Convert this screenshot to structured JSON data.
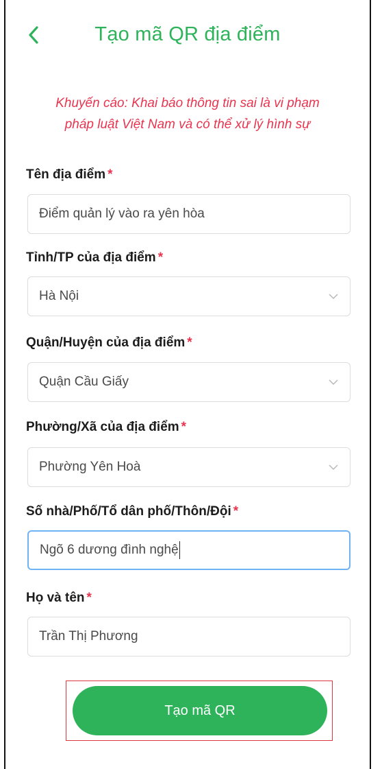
{
  "header": {
    "back_icon": "chevron-left-icon",
    "title": "Tạo mã QR địa điểm"
  },
  "warning": {
    "line1": "Khuyến cáo: Khai báo thông tin sai là vi phạm",
    "line2": "pháp luật Việt Nam và có thể xử lý hình sự"
  },
  "required_mark": "*",
  "form": {
    "location_name": {
      "label": "Tên địa điểm",
      "value": "Điểm quản lý vào ra yên hòa"
    },
    "province": {
      "label": "Tỉnh/TP của địa điểm",
      "value": "Hà Nội"
    },
    "district": {
      "label": "Quận/Huyện của địa điểm",
      "value": "Quận Cầu Giấy"
    },
    "ward": {
      "label": "Phường/Xã của địa điểm",
      "value": "Phường Yên Hoà"
    },
    "address": {
      "label": "Số nhà/Phố/Tổ dân phố/Thôn/Đội",
      "value": "Ngõ 6 dương đình nghệ"
    },
    "full_name": {
      "label": "Họ và tên",
      "value": "Trần Thị Phương"
    }
  },
  "submit": {
    "label": "Tạo mã QR"
  },
  "colors": {
    "accent_green": "#2eb35a",
    "warning_red": "#e8344f",
    "focus_blue": "#6fb3f4",
    "highlight_outline": "#d9363f"
  }
}
